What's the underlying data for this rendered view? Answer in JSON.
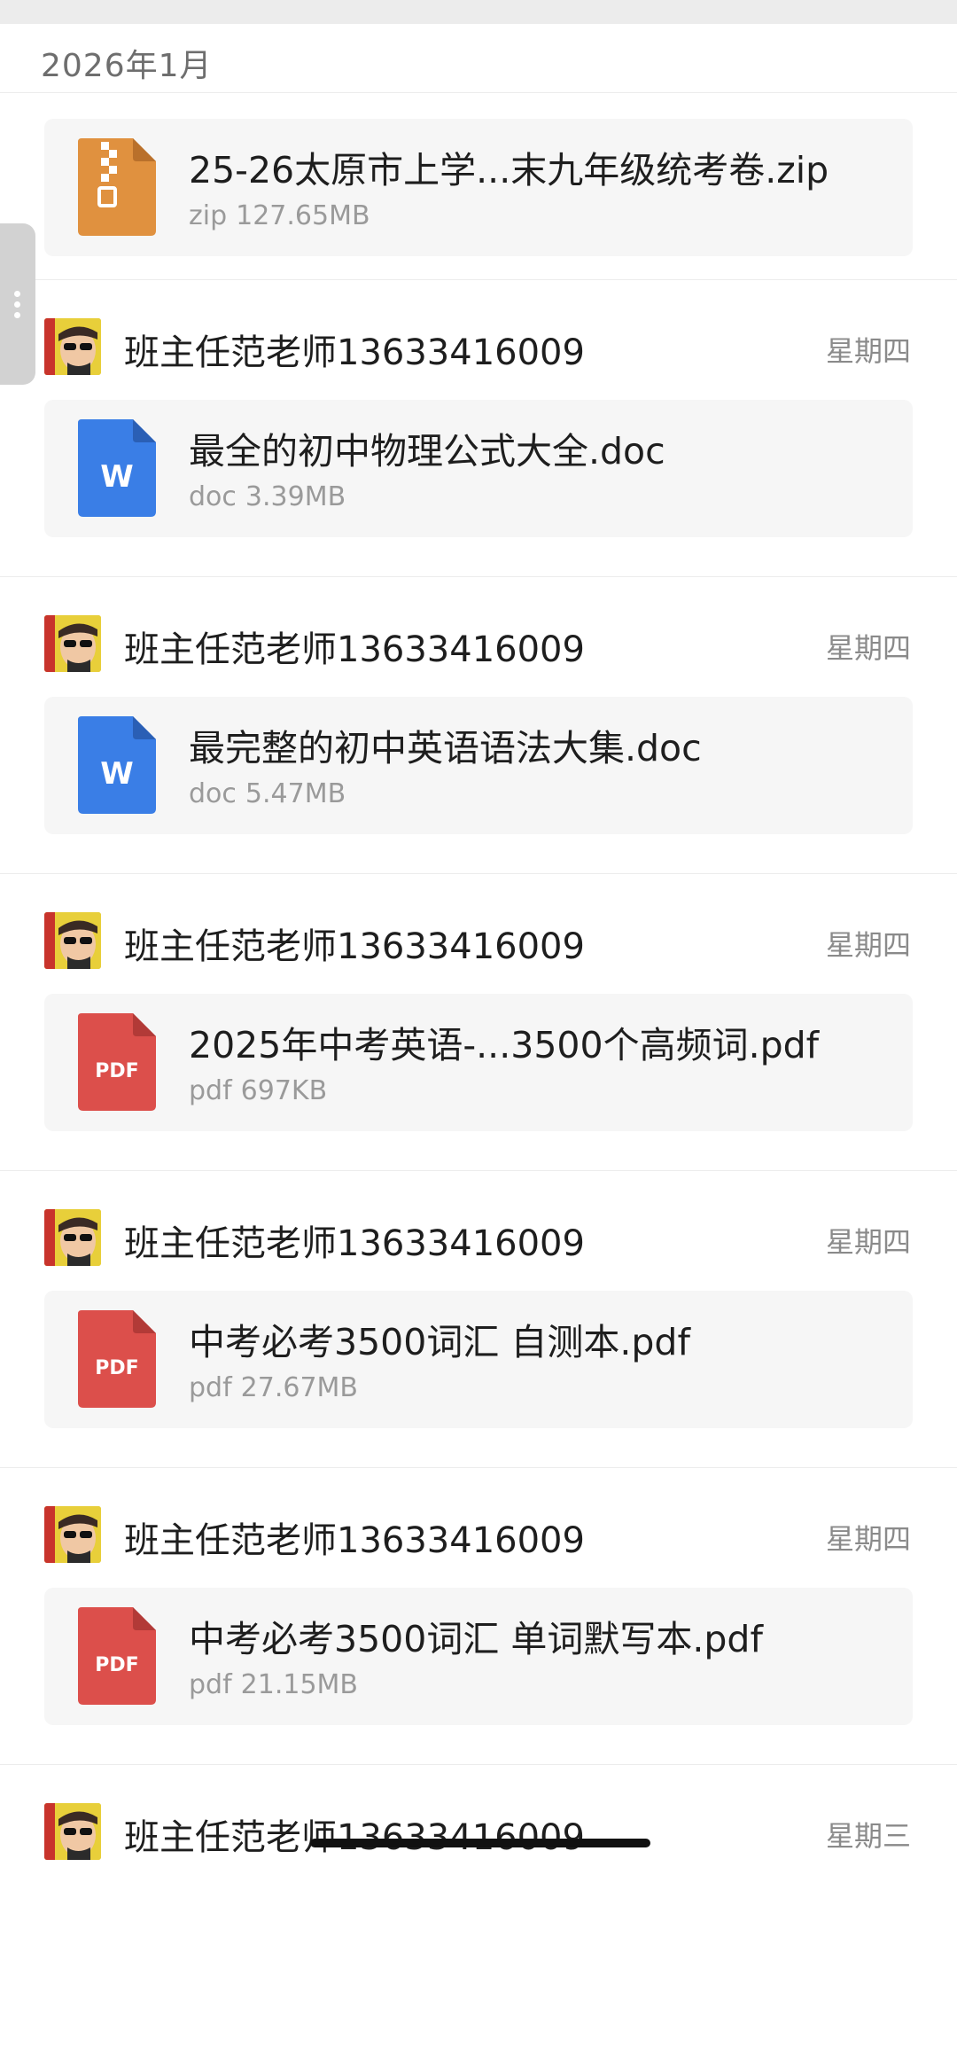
{
  "header": {
    "month": "2026年1月"
  },
  "messages": [
    {
      "file": {
        "name": "25-26太原市上学...末九年级统考卷.zip",
        "type": "zip",
        "size": "127.65MB",
        "icon": "zip-file-icon",
        "color": "#e0913f"
      }
    },
    {
      "sender": {
        "name": "班主任范老师13633416009",
        "day": "星期四"
      },
      "file": {
        "name": "最全的初中物理公式大全.doc",
        "type": "doc",
        "size": "3.39MB",
        "icon": "word-doc-icon",
        "badge": "W",
        "color": "#3a7ee6"
      }
    },
    {
      "sender": {
        "name": "班主任范老师13633416009",
        "day": "星期四"
      },
      "file": {
        "name": "最完整的初中英语语法大集.doc",
        "type": "doc",
        "size": "5.47MB",
        "icon": "word-doc-icon",
        "badge": "W",
        "color": "#3a7ee6"
      }
    },
    {
      "sender": {
        "name": "班主任范老师13633416009",
        "day": "星期四"
      },
      "file": {
        "name": "2025年中考英语-...3500个高频词.pdf",
        "type": "pdf",
        "size": "697KB",
        "icon": "pdf-file-icon",
        "badge": "PDF",
        "color": "#dc4f4b"
      }
    },
    {
      "sender": {
        "name": "班主任范老师13633416009",
        "day": "星期四"
      },
      "file": {
        "name": "中考必考3500词汇 自测本.pdf",
        "type": "pdf",
        "size": "27.67MB",
        "icon": "pdf-file-icon",
        "badge": "PDF",
        "color": "#dc4f4b"
      }
    },
    {
      "sender": {
        "name": "班主任范老师13633416009",
        "day": "星期四"
      },
      "file": {
        "name": "中考必考3500词汇 单词默写本.pdf",
        "type": "pdf",
        "size": "21.15MB",
        "icon": "pdf-file-icon",
        "badge": "PDF",
        "color": "#dc4f4b"
      }
    },
    {
      "sender": {
        "name": "班主任范老师13633416009",
        "day": "星期三"
      }
    }
  ]
}
